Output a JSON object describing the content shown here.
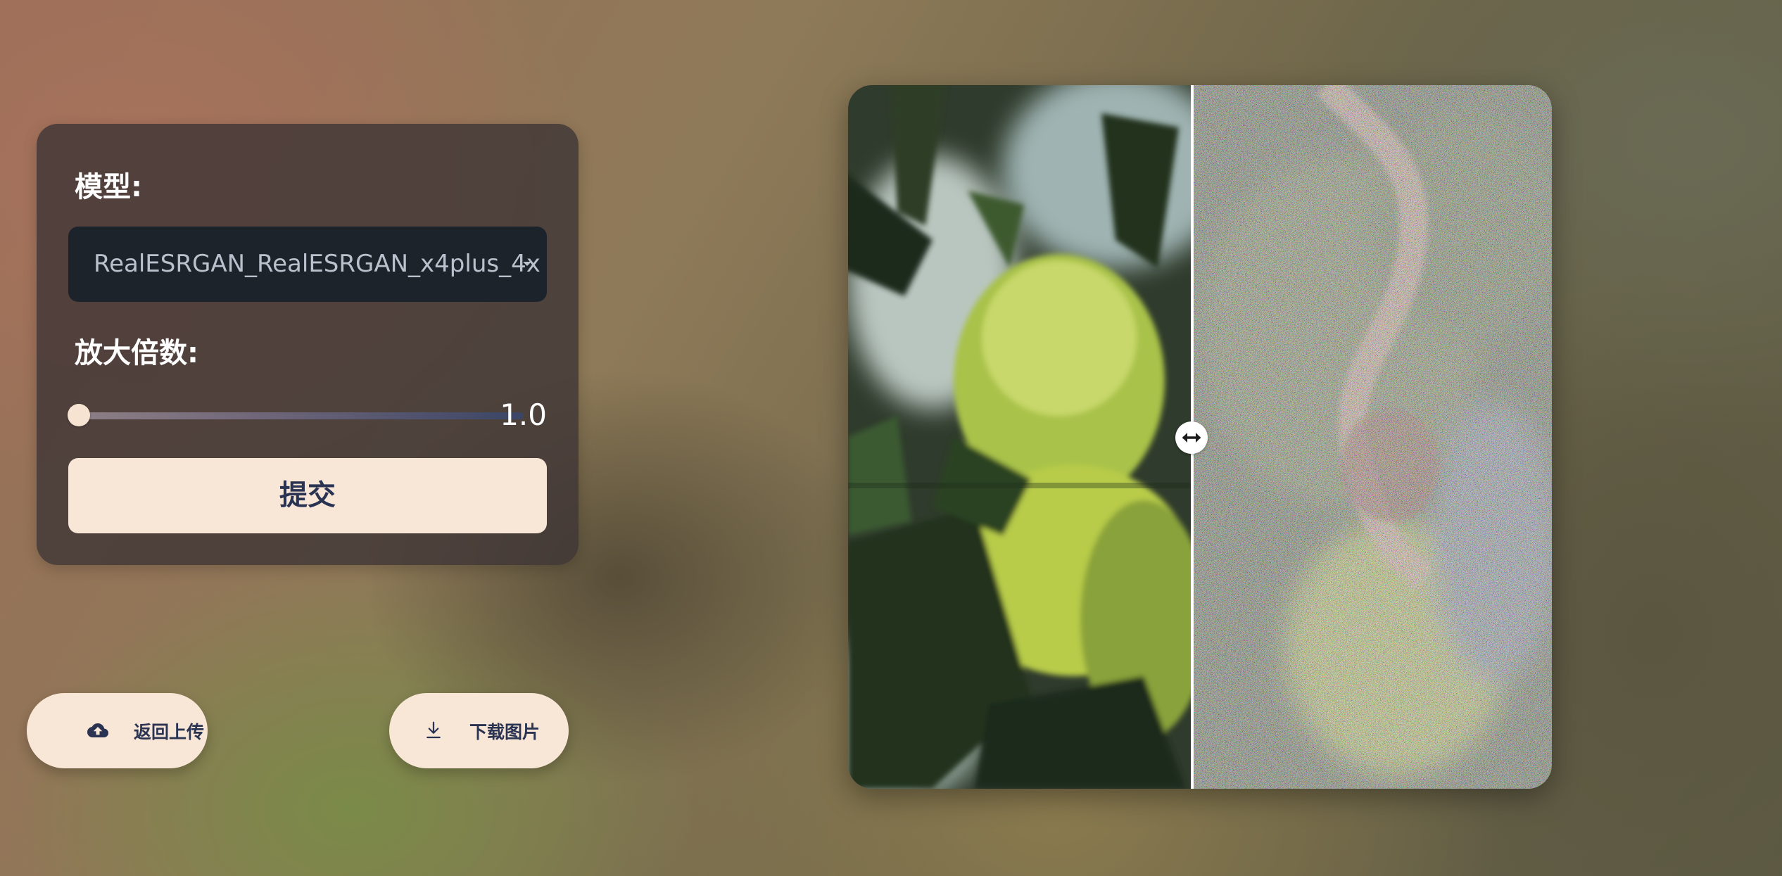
{
  "settings": {
    "model_label": "模型:",
    "model_value": "RealESRGAN_RealESRGAN_x4plus_4x",
    "scale_label": "放大倍数:",
    "scale_value": "1.0",
    "scale_level": 0.0,
    "submit_label": "提交"
  },
  "actions": {
    "back_upload_label": "返回上传",
    "download_label": "下载图片"
  },
  "comparer": {
    "divider_position": 0.49
  },
  "colors": {
    "button_bg": "#f8e7d7",
    "button_text": "#2a3452",
    "panel_bg": "#403636",
    "select_bg": "#1c232b"
  }
}
